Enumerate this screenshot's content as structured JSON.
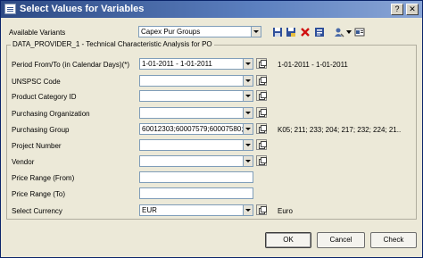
{
  "window": {
    "title": "Select Values for Variables"
  },
  "variants": {
    "label": "Available Variants",
    "value": "Capex Pur Groups"
  },
  "toolbar_icons": [
    "save-icon",
    "save-as-icon",
    "delete-icon",
    "info-icon",
    "personalize-icon",
    "settings-icon"
  ],
  "group": {
    "title": "DATA_PROVIDER_1 - Technical Characteristic Analysis for PO"
  },
  "rows": [
    {
      "label": "Period From/To (in Calendar Days)(*)",
      "value": "1-01-2011 - 1-01-2011",
      "selection": "1-01-2011 - 1-01-2011",
      "type": "combo"
    },
    {
      "label": "UNSPSC Code",
      "value": "",
      "selection": "",
      "type": "combo"
    },
    {
      "label": "Product Category ID",
      "value": "",
      "selection": "",
      "type": "combo"
    },
    {
      "label": "Purchasing Organization",
      "value": "",
      "selection": "",
      "type": "combo"
    },
    {
      "label": "Purchasing Group",
      "value": "60012303;60007579;60007580;",
      "selection": "K05; 211; 233; 204; 217; 232; 224; 21..",
      "type": "combo"
    },
    {
      "label": "Project Number",
      "value": "",
      "selection": "",
      "type": "combo"
    },
    {
      "label": "Vendor",
      "value": "",
      "selection": "",
      "type": "combo"
    },
    {
      "label": "Price Range (From)",
      "value": "",
      "selection": "",
      "type": "text"
    },
    {
      "label": "Price Range (To)",
      "value": "",
      "selection": "",
      "type": "text"
    },
    {
      "label": "Select Currency",
      "value": "EUR",
      "selection": "Euro",
      "type": "combo"
    }
  ],
  "buttons": {
    "ok": "OK",
    "cancel": "Cancel",
    "check": "Check"
  }
}
